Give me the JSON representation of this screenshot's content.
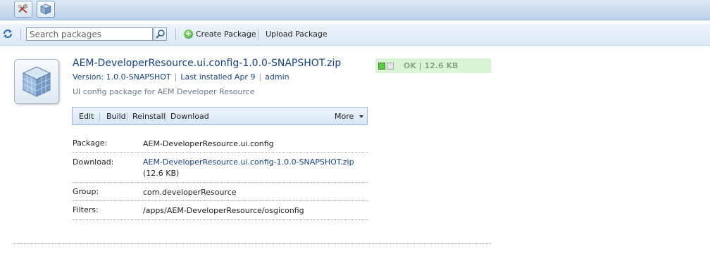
{
  "toolbar": {
    "search_placeholder": "Search packages",
    "create_package": "Create Package",
    "upload_package": "Upload Package"
  },
  "package": {
    "title": "AEM-DeveloperResource.ui.config-1.0.0-SNAPSHOT.zip",
    "version": "Version: 1.0.0-SNAPSHOT",
    "last_installed": "Last installed Apr 9",
    "user": "admin",
    "description": "UI config package for AEM Developer Resource",
    "status": "OK | 12.6 KB",
    "actions": {
      "edit": "Edit",
      "build": "Build",
      "reinstall": "Reinstall",
      "download": "Download",
      "more": "More"
    },
    "details": {
      "package_label": "Package:",
      "package_value": "AEM-DeveloperResource.ui.config",
      "download_label": "Download:",
      "download_link": "AEM-DeveloperResource.ui.config-1.0.0-SNAPSHOT.zip",
      "download_size": "(12.6 KB)",
      "group_label": "Group:",
      "group_value": "com.developerResource",
      "filters_label": "Filters:",
      "filters_value": "/apps/AEM-DeveloperResource/osgiconfig"
    }
  },
  "icons": {
    "tab1": "tools-icon",
    "tab2": "package-icon",
    "refresh": "refresh-icon",
    "search": "search-icon",
    "create": "add-icon",
    "package": "package-cube-icon"
  },
  "colors": {
    "link": "#15428b",
    "status_bg": "#d9f5d4",
    "status_ok": "#5cc748"
  }
}
